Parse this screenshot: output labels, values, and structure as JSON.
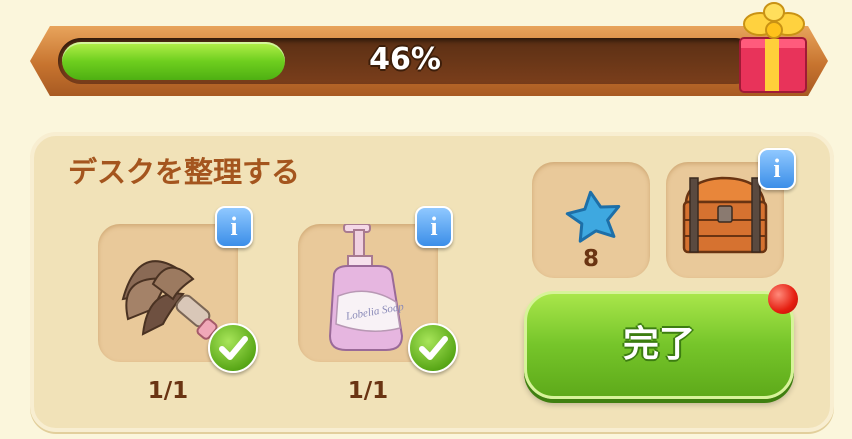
{
  "progress": {
    "value_percent": 46,
    "label": "46%"
  },
  "task": {
    "title": "デスクを整理する",
    "items": [
      {
        "icon": "feather-duster-icon",
        "count_label": "1/1",
        "completed": true
      },
      {
        "icon": "soap-pump-bottle-icon",
        "count_label": "1/1",
        "completed": true
      }
    ],
    "bottle_text": "Lobelia Soap"
  },
  "rewards": [
    {
      "icon": "blue-star-icon",
      "amount": "8"
    },
    {
      "icon": "treasure-chest-icon"
    }
  ],
  "done_button": {
    "label": "完了"
  },
  "info_badge_text": "i",
  "colors": {
    "background": "#fbf6dc",
    "panel": "#f1e2b8",
    "progress_fill": "#6fcf1f",
    "title": "#a4551e",
    "info_badge": "#3b8ee8",
    "done_button": "#76c52a",
    "notification_dot": "#e51e10"
  }
}
